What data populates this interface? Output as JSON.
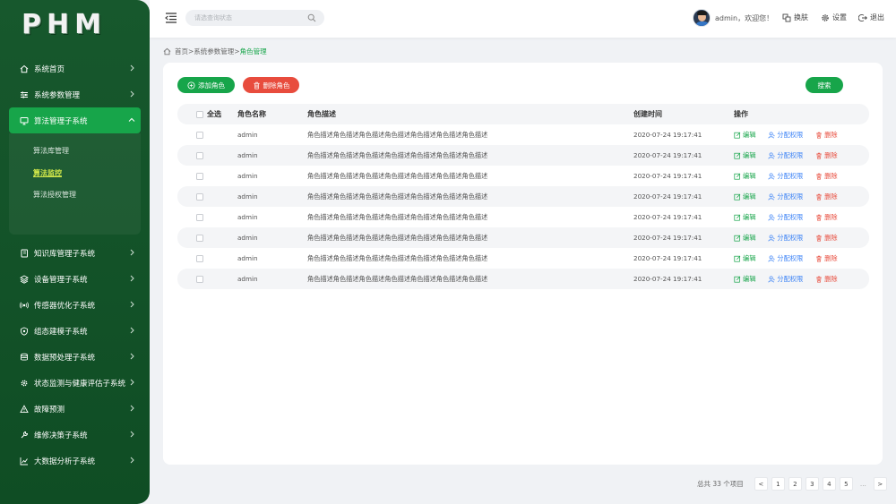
{
  "app": {
    "logo": "PHM"
  },
  "sidebar": {
    "items": [
      {
        "label": "系统首页",
        "icon": "home-icon"
      },
      {
        "label": "系统参数管理",
        "icon": "sliders-icon"
      },
      {
        "label": "算法管理子系统",
        "icon": "monitor-icon",
        "expanded": true,
        "children": [
          {
            "label": "算法库管理"
          },
          {
            "label": "算法监控",
            "current": true
          },
          {
            "label": "算法授权管理"
          }
        ]
      },
      {
        "label": "知识库管理子系统",
        "icon": "book-icon"
      },
      {
        "label": "设备管理子系统",
        "icon": "layers-icon"
      },
      {
        "label": "传感器优化子系统",
        "icon": "sensor-icon"
      },
      {
        "label": "组态建模子系统",
        "icon": "shield-icon"
      },
      {
        "label": "数据预处理子系统",
        "icon": "database-icon"
      },
      {
        "label": "状态监测与健康评估子系统",
        "icon": "gear-icon"
      },
      {
        "label": "故障预测",
        "icon": "alert-icon"
      },
      {
        "label": "维修决策子系统",
        "icon": "wrench-icon"
      },
      {
        "label": "大数据分析子系统",
        "icon": "chart-icon"
      }
    ]
  },
  "header": {
    "search_placeholder": "请选查询状态",
    "greeting": "admin，欢迎您！",
    "skin_label": "换肤",
    "settings_label": "设置",
    "logout_label": "退出"
  },
  "breadcrumb": {
    "home": "首页",
    "sep": ">",
    "parent": "系统参数管理",
    "current": "角色管理"
  },
  "toolbar": {
    "add_label": "添加角色",
    "delete_label": "删除角色",
    "search_label": "搜索"
  },
  "table": {
    "headers": {
      "select_all": "全选",
      "name": "角色名称",
      "desc": "角色描述",
      "time": "创建时间",
      "ops": "操作"
    },
    "op_labels": {
      "edit": "编辑",
      "perm": "分配权限",
      "delete": "删除"
    },
    "rows": [
      {
        "name": "admin",
        "desc": "角色描述角色描述角色描述角色描述角色描述角色描述角色描述",
        "time": "2020-07-24 19:17:41"
      },
      {
        "name": "admin",
        "desc": "角色描述角色描述角色描述角色描述角色描述角色描述角色描述",
        "time": "2020-07-24 19:17:41"
      },
      {
        "name": "admin",
        "desc": "角色描述角色描述角色描述角色描述角色描述角色描述角色描述",
        "time": "2020-07-24 19:17:41"
      },
      {
        "name": "admin",
        "desc": "角色描述角色描述角色描述角色描述角色描述角色描述角色描述",
        "time": "2020-07-24 19:17:41"
      },
      {
        "name": "admin",
        "desc": "角色描述角色描述角色描述角色描述角色描述角色描述角色描述",
        "time": "2020-07-24 19:17:41"
      },
      {
        "name": "admin",
        "desc": "角色描述角色描述角色描述角色描述角色描述角色描述角色描述",
        "time": "2020-07-24 19:17:41"
      },
      {
        "name": "admin",
        "desc": "角色描述角色描述角色描述角色描述角色描述角色描述角色描述",
        "time": "2020-07-24 19:17:41"
      },
      {
        "name": "admin",
        "desc": "角色描述角色描述角色描述角色描述角色描述角色描述角色描述",
        "time": "2020-07-24 19:17:41"
      }
    ]
  },
  "pagination": {
    "total": "总共 33 个项目",
    "prev": "<",
    "pages": [
      "1",
      "2",
      "3",
      "4",
      "5"
    ],
    "ellipsis": "…",
    "next": ">"
  },
  "colors": {
    "primary": "#17a54a",
    "danger": "#e84c3d",
    "link": "#3b82f6",
    "sidebar": "#135a2a"
  }
}
